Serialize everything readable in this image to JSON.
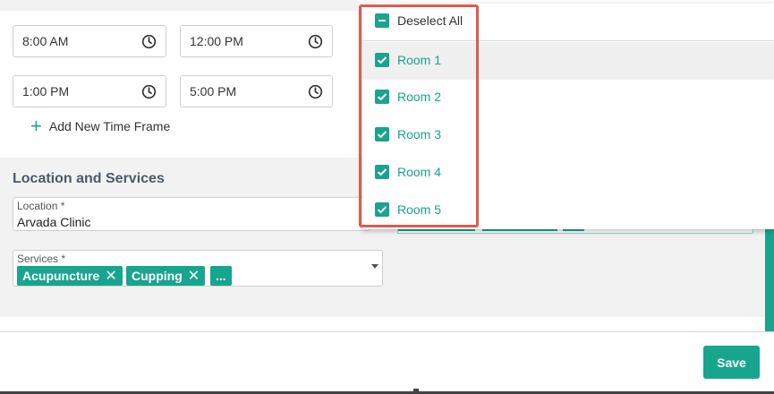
{
  "time_frames": [
    {
      "start": "8:00 AM",
      "end": "12:00 PM"
    },
    {
      "start": "1:00 PM",
      "end": "5:00 PM"
    }
  ],
  "add_time_frame_label": "Add New Time Frame",
  "location_section": {
    "title": "Location and Services",
    "location_label": "Location *",
    "location_value": "Arvada Clinic",
    "services_label": "Services *",
    "services_chips": [
      "Acupuncture",
      "Cupping"
    ],
    "services_more": "..."
  },
  "rooms_dropdown": {
    "deselect_all_label": "Deselect All",
    "items": [
      "Room 1",
      "Room 2",
      "Room 3",
      "Room 4",
      "Room 5"
    ]
  },
  "save_label": "Save",
  "icons": {
    "clock": "clock-icon",
    "plus": "plus-icon",
    "remove": "close-icon",
    "checkbox_checked": "checkbox-checked-icon",
    "checkbox_indeterminate": "checkbox-indeterminate-icon"
  },
  "colors": {
    "accent": "#17a58e",
    "highlight_outline": "#e25a4b",
    "section_title": "#4c5a6b"
  }
}
